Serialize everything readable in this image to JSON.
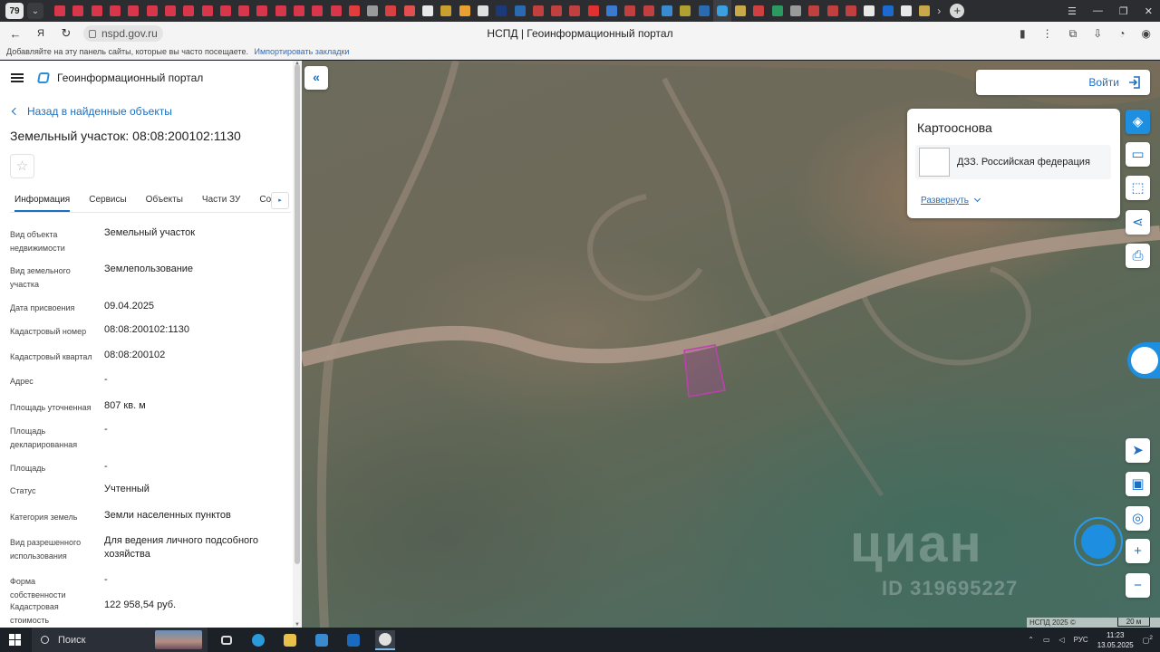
{
  "browser": {
    "tab_count": "79",
    "page_title": "НСПД | Геоинформационный портал",
    "url": "nspd.gov.ru",
    "bookmarks_hint": "Добавляйте на эту панель сайты, которые вы часто посещаете.",
    "bookmarks_import": "Импортировать закладки",
    "tab_icon_colors": [
      "#d8364a",
      "#d8364a",
      "#d8364a",
      "#d8364a",
      "#d8364a",
      "#d8364a",
      "#d8364a",
      "#d8364a",
      "#d8364a",
      "#d8364a",
      "#d8364a",
      "#d8364a",
      "#d8364a",
      "#d8364a",
      "#d8364a",
      "#d8364a",
      "#e23c3c",
      "#9a9a9a",
      "#d94040",
      "#e05050",
      "#e8e8e8",
      "#c8a030",
      "#e8a030",
      "#e0e0e0",
      "#1a3a7a",
      "#2a6ab0",
      "#c04040",
      "#c04040",
      "#c04040",
      "#e03030",
      "#3a7ad0",
      "#c04040",
      "#c04040",
      "#3a8ad0",
      "#b0a030",
      "#2a6ab0",
      "#3aa0e0",
      "#c9a84a",
      "#d04040",
      "#2a9a60",
      "#9a9a9a",
      "#c04040",
      "#c04040",
      "#c04040",
      "#e8e8e8",
      "#1a6ad0",
      "#e8e8e8",
      "#c9a84a"
    ]
  },
  "header": {
    "portal_name": "Геоинформационный портал"
  },
  "panel": {
    "back_label": "Назад в найденные объекты",
    "title": "Земельный участок: 08:08:200102:1130",
    "star": "☆",
    "tabs": [
      {
        "label": "Информация"
      },
      {
        "label": "Сервисы"
      },
      {
        "label": "Объекты"
      },
      {
        "label": "Части ЗУ"
      },
      {
        "label": "Соста"
      }
    ],
    "tabs_arrow": "▸",
    "properties": [
      {
        "label": "Вид объекта недвижимости",
        "value": "Земельный участок"
      },
      {
        "label": "Вид земельного участка",
        "value": "Землепользование"
      },
      {
        "label": "Дата присвоения",
        "value": "09.04.2025"
      },
      {
        "label": "Кадастровый номер",
        "value": "08:08:200102:1130"
      },
      {
        "label": "Кадастровый квартал",
        "value": "08:08:200102"
      },
      {
        "label": "Адрес",
        "value": "-"
      },
      {
        "label": "Площадь уточненная",
        "value": "807 кв. м"
      },
      {
        "label": "Площадь декларированная",
        "value": "-"
      },
      {
        "label": "Площадь",
        "value": "-"
      },
      {
        "label": "Статус",
        "value": "Учтенный"
      },
      {
        "label": "Категория земель",
        "value": "Земли населенных пунктов"
      },
      {
        "label": "Вид разрешенного использования",
        "value": "Для ведения личного подсобного хозяйства"
      },
      {
        "label": "Форма собственности",
        "value": "-"
      },
      {
        "label": "Кадастровая стоимость",
        "value": "122 958,54 руб."
      }
    ]
  },
  "map": {
    "collapse_icon": "«",
    "login_label": "Войти",
    "basemap": {
      "title": "Картооснова",
      "layer_name": "ДЗЗ. Российская федерация",
      "expand_label": "Развернуть"
    },
    "watermark": "циан",
    "watermark_id": "ID 319695227",
    "attribution": "НСПД 2025 ©",
    "scale_label": "20 м",
    "parcel_color": "#c03fb0"
  },
  "taskbar": {
    "search_label": "Поиск",
    "language": "РУС",
    "time": "11:23",
    "date": "13.05.2025",
    "notification_count": "2"
  }
}
